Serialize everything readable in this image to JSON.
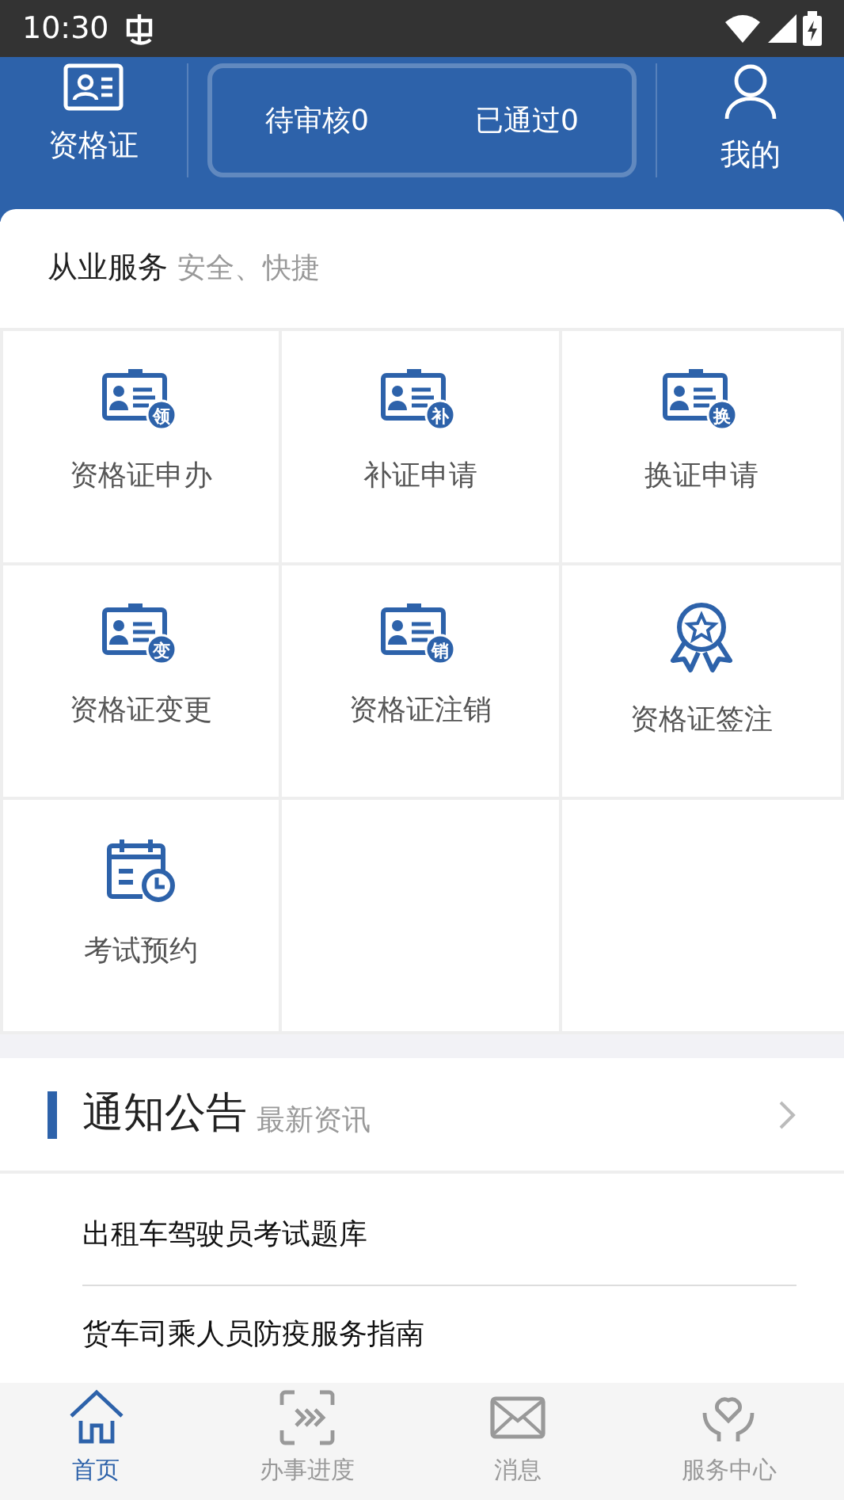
{
  "status_bar": {
    "time": "10:30"
  },
  "header": {
    "left": {
      "label": "资格证"
    },
    "stats": [
      {
        "label": "待审核0"
      },
      {
        "label": "已通过0"
      }
    ],
    "right": {
      "label": "我的"
    }
  },
  "services": {
    "title": "从业服务",
    "subtitle": "安全、快捷",
    "items": [
      {
        "label": "资格证申办",
        "kind": "card",
        "badge": "领"
      },
      {
        "label": "补证申请",
        "kind": "card",
        "badge": "补"
      },
      {
        "label": "换证申请",
        "kind": "card",
        "badge": "换"
      },
      {
        "label": "资格证变更",
        "kind": "card",
        "badge": "变"
      },
      {
        "label": "资格证注销",
        "kind": "card",
        "badge": "销"
      },
      {
        "label": "资格证签注",
        "kind": "award"
      },
      {
        "label": "考试预约",
        "kind": "calendar"
      }
    ]
  },
  "notices": {
    "title": "通知公告",
    "subtitle": "最新资讯",
    "items": [
      "出租车驾驶员考试题库",
      "货车司乘人员防疫服务指南"
    ]
  },
  "tab_bar": [
    {
      "label": "首页",
      "kind": "home",
      "selected": true
    },
    {
      "label": "办事进度",
      "kind": "progress",
      "selected": false
    },
    {
      "label": "消息",
      "kind": "mail",
      "selected": false
    },
    {
      "label": "服务中心",
      "kind": "service",
      "selected": false
    }
  ]
}
